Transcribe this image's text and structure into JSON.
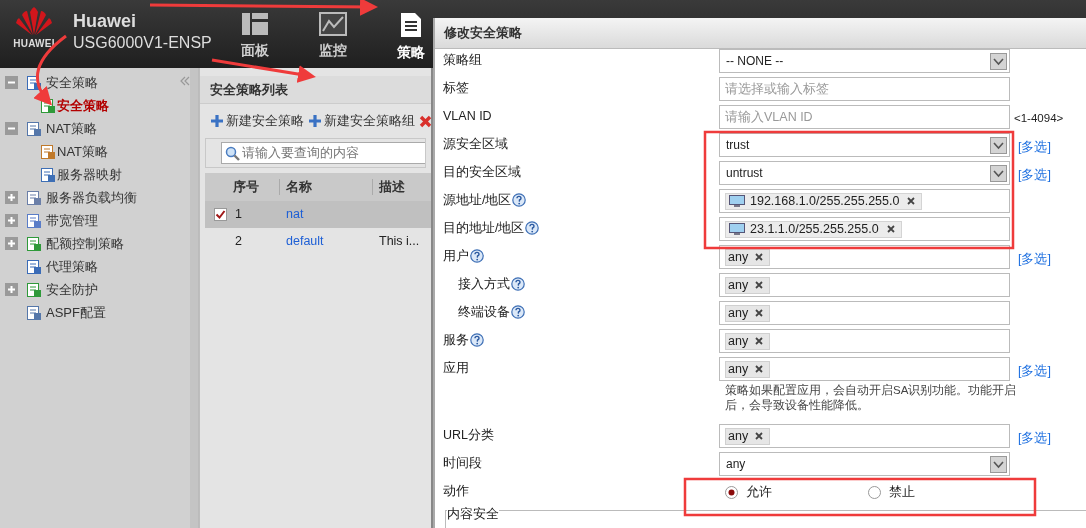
{
  "header": {
    "logo_text": "HUAWEI",
    "title": "Huawei",
    "model": "USG6000V1-ENSP",
    "nav": [
      {
        "label": "面板",
        "selected": false
      },
      {
        "label": "监控",
        "selected": false
      },
      {
        "label": "策略",
        "selected": true
      }
    ]
  },
  "sidebar": {
    "items": [
      {
        "label": "安全策略",
        "selected": false,
        "expanded": true,
        "children": [
          {
            "label": "安全策略",
            "selected": true
          }
        ]
      },
      {
        "label": "NAT策略",
        "selected": false,
        "expanded": true,
        "children": [
          {
            "label": "NAT策略",
            "selected": false
          },
          {
            "label": "服务器映射",
            "selected": false
          }
        ]
      },
      {
        "label": "服务器负载均衡",
        "selected": false,
        "expanded": false
      },
      {
        "label": "带宽管理",
        "selected": false,
        "expanded": false
      },
      {
        "label": "配额控制策略",
        "selected": false,
        "expanded": false
      },
      {
        "label": "代理策略",
        "selected": false
      },
      {
        "label": "安全防护",
        "selected": false,
        "expanded": false
      },
      {
        "label": "ASPF配置",
        "selected": false
      }
    ]
  },
  "policy_list": {
    "title": "安全策略列表",
    "actions": [
      "新建安全策略",
      "新建安全策略组"
    ],
    "search_placeholder": "请输入要查询的内容",
    "columns": [
      "序号",
      "名称",
      "描述"
    ],
    "rows": [
      {
        "checked": true,
        "selected": true,
        "index": "1",
        "name": "nat"
      },
      {
        "checked": false,
        "selected": false,
        "index": "2",
        "name": "default",
        "description": "This i..."
      }
    ]
  },
  "dialog": {
    "title": "修改安全策略",
    "fields": [
      {
        "kind": "select",
        "label": "策略组",
        "help": false,
        "value": "-- NONE --"
      },
      {
        "kind": "input",
        "label": "标签",
        "help": false,
        "placeholder": "请选择或输入标签"
      },
      {
        "kind": "input",
        "label": "VLAN ID",
        "help": false,
        "placeholder": "请输入VLAN ID",
        "hint": "<1-4094>"
      },
      {
        "kind": "select",
        "label": "源安全区域",
        "help": false,
        "value": "trust",
        "link": "[多选]"
      },
      {
        "kind": "select",
        "label": "目的安全区域",
        "help": false,
        "value": "untrust",
        "link": "[多选]"
      },
      {
        "kind": "tags",
        "label": "源地址/地区",
        "help": true,
        "tags": [
          {
            "text": "192.168.1.0/255.255.255.0",
            "kind": "address"
          }
        ]
      },
      {
        "kind": "tags",
        "label": "目的地址/地区",
        "help": true,
        "tags": [
          {
            "text": "23.1.1.0/255.255.255.0",
            "kind": "address"
          }
        ]
      },
      {
        "kind": "tags",
        "label": "用户",
        "help": true,
        "tags": [
          {
            "text": "any",
            "kind": "plain"
          }
        ],
        "link": "[多选]",
        "children": [
          {
            "kind": "tags",
            "label": "接入方式",
            "help": true,
            "tags": [
              {
                "text": "any",
                "kind": "plain"
              }
            ]
          },
          {
            "kind": "tags",
            "label": "终端设备",
            "help": true,
            "tags": [
              {
                "text": "any",
                "kind": "plain"
              }
            ]
          }
        ]
      },
      {
        "kind": "tags",
        "label": "服务",
        "help": true,
        "tags": [
          {
            "text": "any",
            "kind": "plain"
          }
        ]
      },
      {
        "kind": "tags",
        "label": "应用",
        "help": false,
        "tags": [
          {
            "text": "any",
            "kind": "plain"
          }
        ],
        "link": "[多选]",
        "note": "策略如果配置应用，会自动开启SA识别功能。功能开启后，会导致设备性能降低。"
      },
      {
        "kind": "tags",
        "label": "URL分类",
        "help": false,
        "tags": [
          {
            "text": "any",
            "kind": "plain"
          }
        ],
        "link": "[多选]"
      },
      {
        "kind": "select",
        "label": "时间段",
        "help": false,
        "value": "any"
      },
      {
        "kind": "radio",
        "label": "动作",
        "help": false,
        "options": [
          {
            "label": "允许",
            "selected": true
          },
          {
            "label": "禁止",
            "selected": false
          }
        ]
      }
    ],
    "section": "内容安全"
  }
}
